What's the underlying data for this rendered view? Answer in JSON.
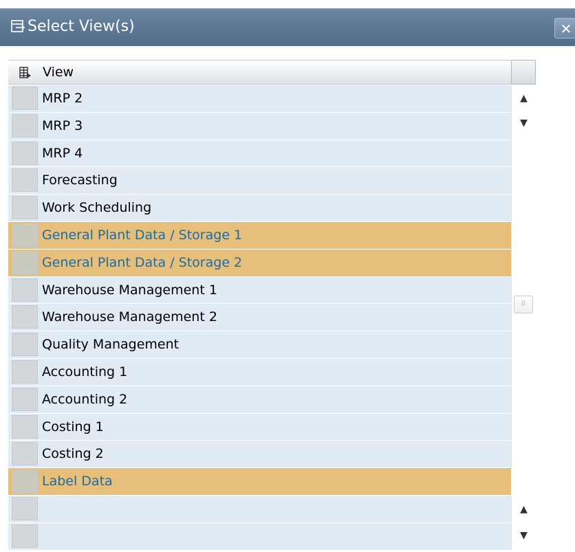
{
  "window": {
    "title": "Select View(s)",
    "title_icon": "select-view-icon",
    "close_icon": "close-icon",
    "close_glyph": "✕"
  },
  "table": {
    "header_icon": "column-settings-icon",
    "column_header": "View",
    "rows": [
      {
        "label": "MRP 2",
        "selected": false
      },
      {
        "label": "MRP 3",
        "selected": false
      },
      {
        "label": "MRP 4",
        "selected": false
      },
      {
        "label": "Forecasting",
        "selected": false
      },
      {
        "label": "Work Scheduling",
        "selected": false
      },
      {
        "label": "General Plant Data / Storage 1",
        "selected": true
      },
      {
        "label": "General Plant Data / Storage 2",
        "selected": true
      },
      {
        "label": "Warehouse Management 1",
        "selected": false
      },
      {
        "label": "Warehouse Management 2",
        "selected": false
      },
      {
        "label": "Quality Management",
        "selected": false
      },
      {
        "label": "Accounting 1",
        "selected": false
      },
      {
        "label": "Accounting 2",
        "selected": false
      },
      {
        "label": "Costing 1",
        "selected": false
      },
      {
        "label": "Costing 2",
        "selected": false
      },
      {
        "label": "Label Data",
        "selected": true
      },
      {
        "label": "",
        "selected": false
      },
      {
        "label": "",
        "selected": false
      }
    ]
  },
  "scrollbar": {
    "up_glyph": "▲",
    "down_glyph": "▼",
    "thumb_glyph": "⠿"
  },
  "colors": {
    "titlebar": "#5d7894",
    "row_bg": "#e1ebf3",
    "selected_row_bg": "#e6c07a",
    "selected_text": "#1f6aa3"
  }
}
